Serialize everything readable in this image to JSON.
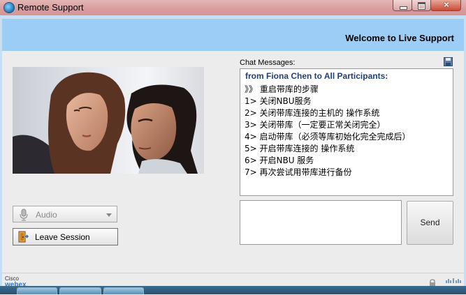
{
  "window": {
    "title": "Remote Support",
    "close_label": "×"
  },
  "header": {
    "welcome": "Welcome to Live Support"
  },
  "audio": {
    "label": "Audio"
  },
  "leave": {
    "label": "Leave Session"
  },
  "chat": {
    "label": "Chat Messages:",
    "from": "from Fiona Chen to All Participants:",
    "lines": [
      "》》 重启带库的步骤",
      "1> 关闭NBU服务",
      "2> 关闭带库连接的主机的 操作系统",
      "3> 关闭带库（一定要正常关闭完全）",
      "4> 启动带库（必须等库初始化完全完成后）",
      "5> 开启带库连接的 操作系统",
      "6> 开启NBU 服务",
      "7> 再次尝试用带库进行备份"
    ],
    "input_value": "",
    "send_label": "Send"
  },
  "footer": {
    "brand_top": "Cisco",
    "brand_bottom": "webex"
  },
  "colors": {
    "header_bg": "#9ccdf6",
    "title_bar": "#d99c9c",
    "from_text": "#1f3f77",
    "webex_blue": "#2f7bc6"
  },
  "icons": [
    "app-icon",
    "microphone-icon",
    "dropdown-arrow-icon",
    "door-exit-icon",
    "save-icon",
    "lock-icon",
    "cisco-logo-icon"
  ]
}
